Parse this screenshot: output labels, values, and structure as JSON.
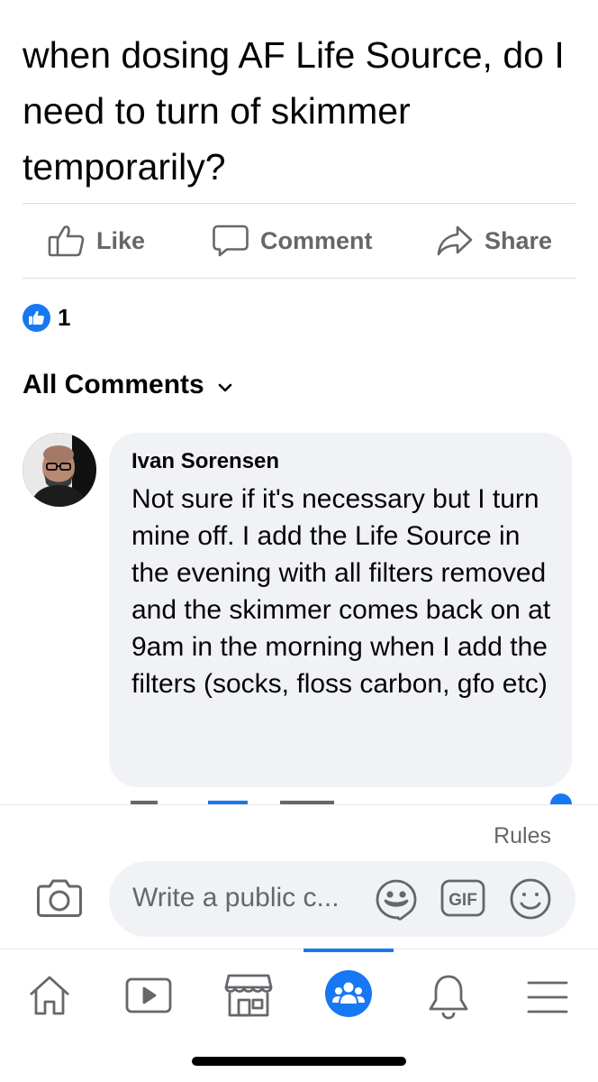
{
  "post": {
    "text": "when dosing AF Life Source, do I need to turn of skimmer temporarily?"
  },
  "actions": {
    "like_label": "Like",
    "comment_label": "Comment",
    "share_label": "Share"
  },
  "reactions": {
    "count": "1"
  },
  "comments_header": {
    "label": "All Comments"
  },
  "comment": {
    "author": "Ivan Sorensen",
    "text": "Not sure if it's necessary but I turn mine off. I add the Life Source in the evening with all filters removed and the skimmer comes back on at 9am in the morning when I add the filters (socks, floss carbon, gfo etc)"
  },
  "composer": {
    "rules_label": "Rules",
    "placeholder": "Write a public c...",
    "gif_label": "GIF"
  },
  "tabbar": {
    "active_tab": "groups",
    "items": [
      "home",
      "watch",
      "marketplace",
      "groups",
      "notifications",
      "menu"
    ]
  },
  "colors": {
    "accent": "#1877f2",
    "secondary_text": "#65676b",
    "bubble_bg": "#f0f2f5"
  }
}
